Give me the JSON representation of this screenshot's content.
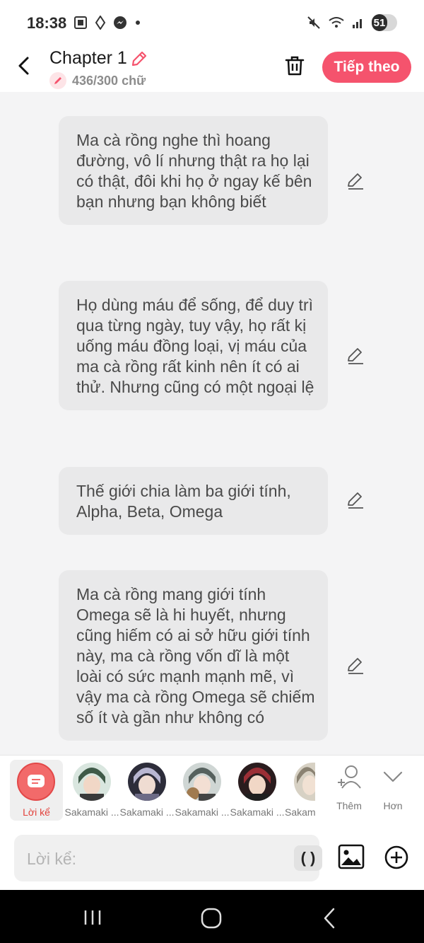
{
  "status_bar": {
    "time": "18:38",
    "battery": "51"
  },
  "header": {
    "title": "Chapter 1",
    "word_count": "436/300 chữ",
    "next_button": "Tiếp theo"
  },
  "paragraphs": [
    {
      "text": "Ma cà rồng nghe thì hoang đường, vô lí nhưng thật ra họ lại có thật, đôi khi họ ở ngay kế bên bạn nhưng bạn không biết"
    },
    {
      "text": "Họ dùng máu để sống, để duy trì qua từng ngày, tuy vậy, họ rất kị uống máu đồng loại, vị máu của ma cà rồng rất kinh nên ít có ai thử. Nhưng cũng có một ngoại lệ"
    },
    {
      "text": "Thế giới chia làm ba giới tính, Alpha, Beta, Omega"
    },
    {
      "text": "Ma cà rồng mang giới tính Omega sẽ là hi huyết, nhưng cũng hiếm có ai sở hữu giới tính này, ma cà rồng vốn dĩ là một loài có sức mạnh mạnh mẽ, vì vậy ma cà rồng Omega sẽ chiếm số ít và gần như không có"
    }
  ],
  "character_bar": {
    "narrator_label": "Lời kể",
    "characters": [
      {
        "name": "Sakamaki ...",
        "color": "#3f5a48"
      },
      {
        "name": "Sakamaki ...",
        "color": "#6d6b86"
      },
      {
        "name": "Sakamaki ...",
        "color": "#56615e"
      },
      {
        "name": "Sakamaki ...",
        "color": "#7c2a2e"
      },
      {
        "name": "Sakam",
        "color": "#8a8272"
      }
    ],
    "more_label": "Thêm",
    "collapse_label": "Hơn"
  },
  "input_bar": {
    "placeholder": "Lời kể:",
    "paren_button": "( )"
  },
  "colors": {
    "accent": "#f5536d",
    "narrator": "#f26a6a"
  }
}
